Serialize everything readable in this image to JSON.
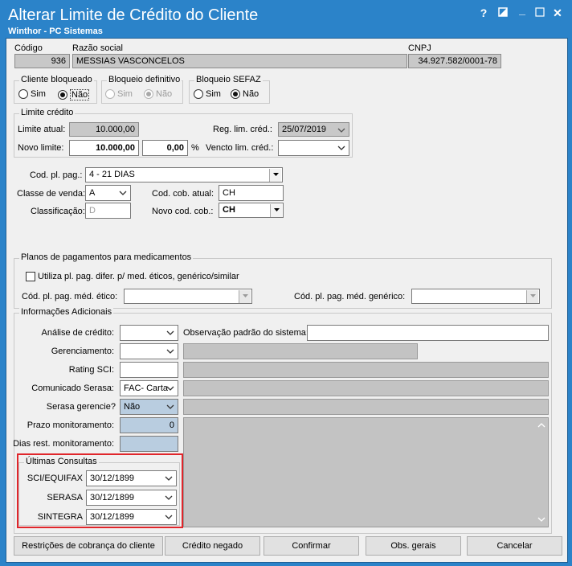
{
  "window": {
    "title": "Alterar Limite de Crédito do Cliente",
    "subtitle": "Winthor - PC Sistemas",
    "help": "?",
    "close": "✕"
  },
  "client": {
    "codigo_label": "Código",
    "codigo": "936",
    "razao_label": "Razão social",
    "razao": "MESSIAS VASCONCELOS",
    "cnpj_label": "CNPJ",
    "cnpj": "34.927.582/0001-78"
  },
  "bloqueio": {
    "cliente_label": "Cliente bloqueado",
    "definitivo_label": "Bloqueio definitivo",
    "sefaz_label": "Bloqueio SEFAZ",
    "sim": "Sim",
    "nao": "Não"
  },
  "limite": {
    "group_label": "Limite crédito",
    "atual_label": "Limite atual:",
    "atual": "10.000,00",
    "novo_label": "Novo limite:",
    "novo": "10.000,00",
    "percent": "0,00",
    "percent_sign": "%",
    "reg_label": "Reg. lim. créd.:",
    "reg": "25/07/2019",
    "vencto_label": "Vencto lim. créd.:",
    "vencto": ""
  },
  "pagamento": {
    "cod_pl_label": "Cod. pl. pag.:",
    "cod_pl": "4 - 21 DIAS",
    "classe_label": "Classe de venda:",
    "classe": "A",
    "classificacao_label": "Classificação:",
    "classificacao": "D",
    "cod_cob_atual_label": "Cod. cob. atual:",
    "cod_cob_atual": "CH",
    "novo_cod_cob_label": "Novo cod. cob.:",
    "novo_cod_cob": "CH"
  },
  "medicamentos": {
    "group_label": "Planos de pagamentos para medicamentos",
    "checkbox_label": "Utiliza pl. pag. difer. p/ med. éticos, genérico/similar",
    "etico_label": "Cód. pl. pag. méd. ético:",
    "generico_label": "Cód. pl. pag. méd. genérico:"
  },
  "info": {
    "group_label": "Informações Adicionais",
    "analise_label": "Análise de crédito:",
    "observacao_label": "Observação padrão do sistema:",
    "gerenciamento_label": "Gerenciamento:",
    "rating_label": "Rating SCI:",
    "comunicado_label": "Comunicado Serasa:",
    "comunicado": "FAC- Carta",
    "serasa_ger_label": "Serasa gerencie?",
    "serasa_ger": "Não",
    "prazo_label": "Prazo monitoramento:",
    "prazo": "0",
    "dias_label": "Dias rest. monitoramento:"
  },
  "consultas": {
    "group_label": "Últimas Consultas",
    "rows": [
      {
        "label": "SCI/EQUIFAX",
        "value": "30/12/1899"
      },
      {
        "label": "SERASA",
        "value": "30/12/1899"
      },
      {
        "label": "SINTEGRA",
        "value": "30/12/1899"
      }
    ]
  },
  "buttons": {
    "restricoes": "Restrições de cobrança do cliente",
    "credito_negado": "Crédito negado",
    "confirmar": "Confirmar",
    "obs_gerais": "Obs. gerais",
    "cancelar": "Cancelar"
  },
  "colors": {
    "titlebar": "#2b83c9",
    "highlight": "#e0262b",
    "selected_field": "#b9cde0"
  }
}
